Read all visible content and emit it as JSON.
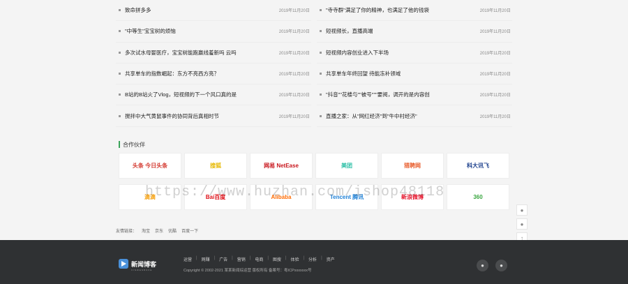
{
  "news": {
    "left": [
      {
        "title": "致命拼多多",
        "date": "2019年11月20日"
      },
      {
        "title": "\"中等生\"宝宝树的烦恼",
        "date": "2019年11月20日"
      },
      {
        "title": "多次试水母婴医疗，宝宝树能跑赢线羞新吗 云吗",
        "date": "2019年11月20日"
      },
      {
        "title": "共享单车的指数崛起：东方不亮西方亮？",
        "date": "2019年11月20日"
      },
      {
        "title": "B站的B站火了Vlog，短视频的下一个风口真的是",
        "date": "2019年11月20日"
      },
      {
        "title": "搅拌中大气黄鼠事件的协同背后真相时节",
        "date": "2019年11月20日"
      }
    ],
    "right": [
      {
        "title": "\"寺寺群\"满足了你的精神，也满足了他的钱袋",
        "date": "2019年11月20日"
      },
      {
        "title": "短视频长，直播高端",
        "date": "2019年11月20日"
      },
      {
        "title": "短视频内容创业进入下半场",
        "date": "2019年11月20日"
      },
      {
        "title": "共享单车年终回望 待能冻补领域",
        "date": "2019年11月20日"
      },
      {
        "title": "\"抖音\"\"花楼与\"\"被号\"\"\"要阅，调开的是内容创",
        "date": "2019年11月20日"
      },
      {
        "title": "直播之家：从\"网红经济\"到\"牛中村经济\"",
        "date": "2019年11月20日"
      }
    ]
  },
  "partners": {
    "title": "合作伙伴",
    "logos": [
      {
        "label": "头条 今日头条",
        "color": "#d43c33"
      },
      {
        "label": "搜狐",
        "color": "#e6b800"
      },
      {
        "label": "网易 NetEase",
        "color": "#c8161d"
      },
      {
        "label": "美团",
        "color": "#2bbfa6"
      },
      {
        "label": "猎聘网",
        "color": "#e85c2b"
      },
      {
        "label": "科大讯飞",
        "color": "#1b3f8c"
      },
      {
        "label": "滴滴",
        "color": "#f59b00"
      },
      {
        "label": "Bai百度",
        "color": "#de0f17"
      },
      {
        "label": "Alibaba",
        "color": "#ff6a00"
      },
      {
        "label": "Tencent 腾讯",
        "color": "#1c7fd6"
      },
      {
        "label": "新浪微博",
        "color": "#e6162d"
      },
      {
        "label": "360",
        "color": "#3aa640"
      }
    ]
  },
  "friend_links": {
    "label": "友情链接：",
    "items": [
      "淘宝",
      "京东",
      "优酷",
      "百度一下"
    ]
  },
  "watermark": "https://www.huzhan.com/ishop48118",
  "footer": {
    "brand": "新闻博客",
    "brand_sub": "XINWENBOKE",
    "nav": [
      "运营",
      "网赚",
      "广告",
      "营销",
      "电商",
      "图搜",
      "体验",
      "分析",
      "资产"
    ],
    "copyright": "Copyright © 2002-2021 某某新闻综运营 版权所有 备案号：粤ICPxxxxxxx号"
  }
}
